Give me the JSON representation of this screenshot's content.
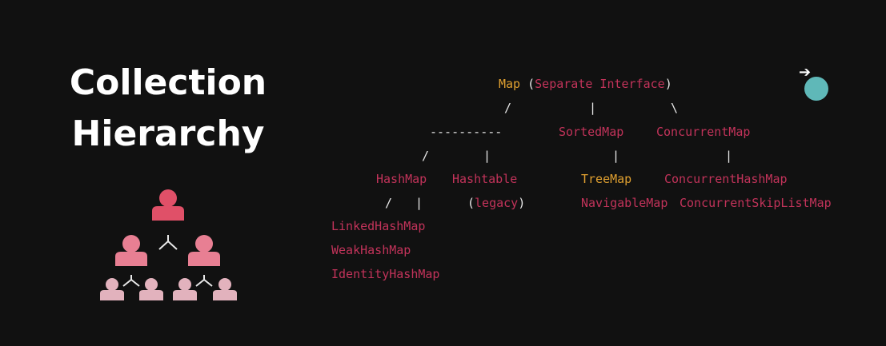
{
  "title": {
    "line1": "Collection",
    "line2": "Hierarchy"
  },
  "diagram": {
    "root": {
      "name": "Map",
      "open": "(",
      "note": "Separate Interface",
      "close": ")"
    },
    "dashes": "----------",
    "sorted_map": "SortedMap",
    "concurrent_map": "ConcurrentMap",
    "hash_map": "HashMap",
    "hashtable": "Hashtable",
    "legacy": {
      "open": "(",
      "text": "legacy",
      "close": ")"
    },
    "tree_map": "TreeMap",
    "navigable_map": "NavigableMap",
    "concurrent_hash_map": "ConcurrentHashMap",
    "concurrent_skip_list_map": "ConcurrentSkipListMap",
    "linked_hash_map": "LinkedHashMap",
    "weak_hash_map": "WeakHashMap",
    "identity_hash_map": "IdentityHashMap",
    "connectors": {
      "slash": "/",
      "pipe": "|",
      "backslash": "\\"
    }
  },
  "icons": {
    "org_chart": "people-hierarchy-icon",
    "pointer": "arrow-pointer-icon"
  },
  "colors": {
    "background": "#111111",
    "class_name": "#c2335a",
    "highlight": "#e0a030",
    "cursor": "#5fb8b8",
    "person_top": "#e05068",
    "person_mid": "#e87f93",
    "person_bottom": "#e2b2bd"
  }
}
